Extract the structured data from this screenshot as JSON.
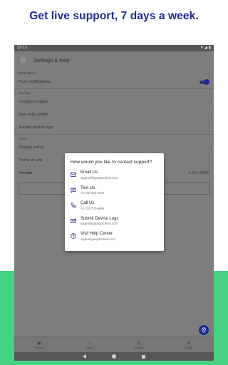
{
  "headline": "Get live support, 7 days a week.",
  "colors": {
    "brand": "#1d2a8c",
    "accent_green": "#45d285"
  },
  "statusbar": {
    "time": "12:13",
    "icons": [
      "wifi-icon",
      "signal-icon",
      "battery-icon"
    ]
  },
  "appbar": {
    "title": "Settings & help"
  },
  "settings": {
    "notifications_label": "Notifications",
    "push_notifications": "Push notifications",
    "push_enabled": true,
    "get_help_label": "Get help",
    "contact_support": "Contact support",
    "visit_help_center": "Visit help center",
    "submit_device_logs": "Submit device logs",
    "about_label": "About",
    "privacy_policy": "Privacy policy",
    "terms_of_use": "Terms of use",
    "version_label": "Version",
    "version_value": "4.24.5 (515)"
  },
  "dialog": {
    "title": "How would you like to contact support?",
    "options": [
      {
        "label": "Email Us",
        "sub": "support@gospotcheck.com",
        "icon": "mail-icon"
      },
      {
        "label": "Text Us",
        "sub": "+1-720-444-4273",
        "icon": "message-icon"
      },
      {
        "label": "Call Us",
        "sub": "+1-720-773-6696",
        "icon": "phone-icon"
      },
      {
        "label": "Submit Device Logs",
        "sub": "support@gospotcheck.com",
        "icon": "mail-icon"
      },
      {
        "label": "Visit Help Center",
        "sub": "support.gospotcheck.com",
        "icon": "help-circle-icon"
      }
    ]
  },
  "bottom_nav": [
    {
      "label": "Missions",
      "icon": "missions-icon"
    },
    {
      "label": "Activity",
      "icon": "activity-icon"
    },
    {
      "label": "Journeys",
      "icon": "journeys-icon"
    },
    {
      "label": "Settings",
      "icon": "settings-icon"
    }
  ]
}
